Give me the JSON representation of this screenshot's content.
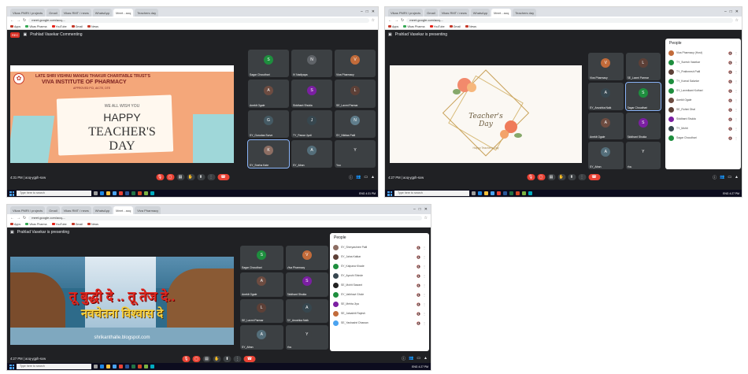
{
  "shot1": {
    "tabs": [
      "Vikas PMRI / projects",
      "Gmail",
      "Vikas RMT / news",
      "WhatsApp",
      "Meet - aoq",
      "Teachers day"
    ],
    "url": "meet.google.com/aoq-...",
    "bookmarks": [
      "Apps",
      "Vikas Pharma",
      "YouTube",
      "Gmail",
      "News"
    ],
    "banner_text": "Prahlad Vasekar Commenting",
    "rec_label": "REC",
    "slide": {
      "trust": "LATE SHRI VISHNU MANSAI THAKUR CHARITABLE TRUST'S",
      "institute": "VIVA INSTITUTE OF PHARMACY",
      "sub": "APPROVED PCI, AICTE, DTE",
      "wish": "WE ALL WISH YOU",
      "happy": "HAPPY",
      "teachers": "TEACHER'S",
      "day": "DAY"
    },
    "tiles": [
      {
        "name": "Sagar Choudhari",
        "initial": "S",
        "color": "#1e8e3e"
      },
      {
        "name": "IV Nadiyapa",
        "initial": "N",
        "color": "#5f6368"
      },
      {
        "name": "Viva Pharmacy",
        "initial": "V",
        "color": "#c26b3a"
      },
      {
        "name": "Anekit Ogale",
        "initial": "A",
        "color": "#6d4c41"
      },
      {
        "name": "Siddhant Shukla",
        "initial": "S",
        "color": "#7b1fa2"
      },
      {
        "name": "SE_Laxmi Parmar",
        "initial": "L",
        "color": "#5d4037"
      },
      {
        "name": "SY_Gurudas Surve",
        "initial": "G",
        "color": "#455a64"
      },
      {
        "name": "TY_Pawar Jyoti",
        "initial": "J",
        "color": "#37474f"
      },
      {
        "name": "SY_Nikitas Patil",
        "initial": "N",
        "color": "#607d8b"
      },
      {
        "name": "SY_Sneha Kate",
        "initial": "K",
        "color": "#8d6e63"
      },
      {
        "name": "SY_Afran",
        "initial": "A",
        "color": "#546e7a"
      },
      {
        "name": "You",
        "initial": "Y",
        "color": "#3c4043"
      }
    ],
    "meeting_time": "4:31 PM",
    "meeting_code": "aoq-ygph-sxw",
    "search_text": "Type here to search",
    "tray": "ENG  4:31 PM"
  },
  "shot2": {
    "tabs": [
      "Vikas PMRI / projects",
      "Gmail",
      "Vikas RMT / news",
      "WhatsApp",
      "Meet - aoq",
      "Teachers day"
    ],
    "url": "meet.google.com/aoq-...",
    "bookmarks": [
      "Apps",
      "Vikas Pharma",
      "YouTube",
      "Gmail",
      "News"
    ],
    "banner_text": "Prahlad Vasekar is presenting",
    "slide": {
      "teachers": "Teacher's",
      "day": "Day",
      "small": "Happy Teacher's Day"
    },
    "tiles": [
      {
        "name": "Viva Pharmacy",
        "initial": "V",
        "color": "#c26b3a"
      },
      {
        "name": "SE_Laxmi Parmar",
        "initial": "L",
        "color": "#5d4037"
      },
      {
        "name": "SY_Anushka Naik",
        "initial": "A",
        "color": "#37474f"
      },
      {
        "name": "Sagar Choudhari",
        "initial": "S",
        "color": "#1e8e3e"
      },
      {
        "name": "Anekit Ogale",
        "initial": "A",
        "color": "#6d4c41"
      },
      {
        "name": "Siddhant Shukla",
        "initial": "S",
        "color": "#7b1fa2"
      },
      {
        "name": "SY_Afran",
        "initial": "A",
        "color": "#546e7a"
      },
      {
        "name": "You",
        "initial": "Y",
        "color": "#3c4043"
      }
    ],
    "people_title": "People",
    "people": [
      {
        "name": "Viva Pharmacy (Host)",
        "color": "#c26b3a"
      },
      {
        "name": "TY_Suresh Vasekar",
        "color": "#1e8e3e"
      },
      {
        "name": "TY_Prathmesh Patil",
        "color": "#5d4037"
      },
      {
        "name": "TY_Komal Salunke",
        "color": "#1e8e3e"
      },
      {
        "name": "SY_Laxmikant Kothari",
        "color": "#1e8e3e"
      },
      {
        "name": "Anekit Ogale",
        "color": "#6d4c41"
      },
      {
        "name": "SE_Rohini Dhal",
        "color": "#5d4037"
      },
      {
        "name": "Siddhant Shukla",
        "color": "#7b1fa2"
      },
      {
        "name": "TY_Mohit",
        "color": "#37474f"
      },
      {
        "name": "Sagar Choudhari",
        "color": "#1e8e3e"
      }
    ],
    "meeting_time": "4:27 PM",
    "meeting_code": "aoq-ygph-sxw",
    "search_text": "Type here to search",
    "tray": "ENG  4:27 PM"
  },
  "shot3": {
    "tabs": [
      "Vikas PMRI / projects",
      "Gmail",
      "Vikas RMT / news",
      "WhatsApp",
      "Meet - aoq",
      "Viva Pharmacy"
    ],
    "url": "meet.google.com/aoq-...",
    "bookmarks": [
      "Apps",
      "Vikas Pharma",
      "YouTube",
      "Gmail",
      "News"
    ],
    "banner_text": "Prahlad Vasekar is presenting",
    "slide": {
      "line1": "तू बुद्धी दे .. तू तेज दे..",
      "line2": "नवचेतना विश्वास दे",
      "site": "shrikanthalle.blogspot.com"
    },
    "tiles": [
      {
        "name": "Sagar Choudhari",
        "initial": "S",
        "color": "#1e8e3e"
      },
      {
        "name": "Viva Pharmacy",
        "initial": "V",
        "color": "#c26b3a"
      },
      {
        "name": "Anekit Ogale",
        "initial": "A",
        "color": "#6d4c41"
      },
      {
        "name": "Siddhant Shukla",
        "initial": "S",
        "color": "#7b1fa2"
      },
      {
        "name": "SE_Laxmi Parmar",
        "initial": "L",
        "color": "#5d4037"
      },
      {
        "name": "SY_Anushka Naik",
        "initial": "A",
        "color": "#37474f"
      },
      {
        "name": "SY_Afran",
        "initial": "A",
        "color": "#546e7a"
      },
      {
        "name": "You",
        "initial": "Y",
        "color": "#3c4043"
      }
    ],
    "people_title": "People",
    "people": [
      {
        "name": "SY_Shreyashree Patil",
        "color": "#8d6e63"
      },
      {
        "name": "SY_Jaina Katkar",
        "color": "#5d4037"
      },
      {
        "name": "SY_Kalpana Khade",
        "color": "#1e8e3e"
      },
      {
        "name": "SY_Ayushi Shinde",
        "color": "#37474f"
      },
      {
        "name": "SE_Mohit Sawant",
        "color": "#212121"
      },
      {
        "name": "SY_Vaibhavi Ghole",
        "color": "#1e8e3e"
      },
      {
        "name": "SE_Mehta Jiya",
        "color": "#7b1fa2"
      },
      {
        "name": "SE_Jaisakhil Rajesh",
        "color": "#c26b3a"
      },
      {
        "name": "SE_Yashashri Dhawan",
        "color": "#4aa3f0"
      }
    ],
    "meeting_time": "4:27 PM",
    "meeting_code": "aoq-ygph-sxw",
    "search_text": "Type here to search",
    "tray": "ENG  4:27 PM"
  }
}
